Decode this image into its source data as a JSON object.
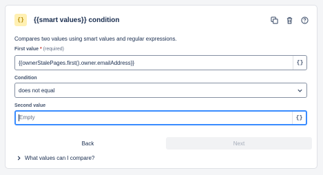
{
  "header": {
    "badge": "{}",
    "title": "{{smart values}} condition",
    "actions": [
      "duplicate-icon",
      "trash-icon",
      "help-icon"
    ]
  },
  "description": "Compares two values using smart values and regular expressions.",
  "first_value": {
    "label": "First value",
    "required_mark": "*",
    "hint": "(required)",
    "value": "{{ownerStalePages.first().owner.emailAddress}}",
    "smart_button": "{}"
  },
  "condition": {
    "label": "Condition",
    "selected": "does not equal"
  },
  "second_value": {
    "label": "Second value",
    "placeholder": "Empty",
    "value": "",
    "smart_button": "{}"
  },
  "buttons": {
    "back": "Back",
    "next": "Next"
  },
  "expander": {
    "label": "What values can I compare?"
  },
  "colors": {
    "accent": "#388bff",
    "badge_bg": "#fff0b3",
    "required": "#c9372c"
  }
}
